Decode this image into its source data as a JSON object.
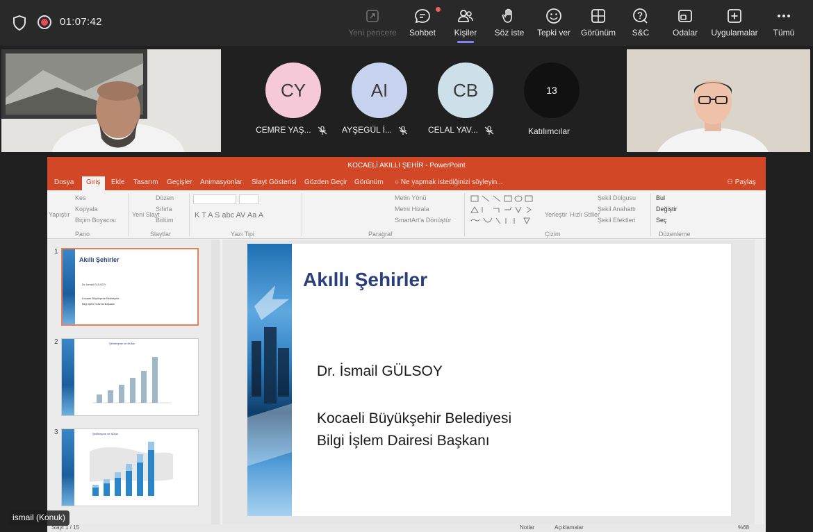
{
  "meeting": {
    "timer": "01:07:42",
    "toolbar": [
      {
        "label": "Yeni pencere",
        "icon": "new-window-icon",
        "enabled": false
      },
      {
        "label": "Sohbet",
        "icon": "chat-icon",
        "enabled": true
      },
      {
        "label": "Kişiler",
        "icon": "people-icon",
        "enabled": true,
        "active": true
      },
      {
        "label": "Söz iste",
        "icon": "raise-hand-icon",
        "enabled": true
      },
      {
        "label": "Tepki ver",
        "icon": "smiley-icon",
        "enabled": true
      },
      {
        "label": "Görünüm",
        "icon": "grid-icon",
        "enabled": true
      },
      {
        "label": "S&C",
        "icon": "qa-icon",
        "enabled": true
      },
      {
        "label": "Odalar",
        "icon": "rooms-icon",
        "enabled": true
      },
      {
        "label": "Uygulamalar",
        "icon": "apps-icon",
        "enabled": true
      },
      {
        "label": "Tümü",
        "icon": "more-icon",
        "enabled": true
      }
    ],
    "participants": [
      {
        "initials": "CY",
        "name": "CEMRE YAŞ...",
        "color": "#f5c9d8"
      },
      {
        "initials": "AI",
        "name": "AYŞEGÜL İ...",
        "color": "#c7d3ee"
      },
      {
        "initials": "CB",
        "name": "CELAL YAV...",
        "color": "#cde0ea"
      }
    ],
    "more_participants": {
      "count": "13",
      "label": "Katılımcılar"
    },
    "presenter_tag": "ismail (Konuk)"
  },
  "powerpoint": {
    "window_title": "KOCAELİ AKILLI ŞEHİR - PowerPoint",
    "tabs": [
      "Dosya",
      "Giriş",
      "Ekle",
      "Tasarım",
      "Geçişler",
      "Animasyonlar",
      "Slayt Gösterisi",
      "Gözden Geçir",
      "Görünüm"
    ],
    "selected_tab": "Giriş",
    "tell_me": "Ne yapmak istediğinizi söyleyin...",
    "share": "Paylaş",
    "ribbon": {
      "clipboard": {
        "paste": "Yapıştır",
        "cut": "Kes",
        "copy": "Kopyala",
        "format": "Biçim Boyacısı",
        "group": "Pano"
      },
      "slides": {
        "new": "Yeni Slayt",
        "layout": "Düzen",
        "reset": "Sıfırla",
        "section": "Bölüm",
        "group": "Slaytlar"
      },
      "font": {
        "group": "Yazı Tipi"
      },
      "paragraph": {
        "direction": "Metin Yönü",
        "align": "Metni Hizala",
        "smartart": "SmartArt'a Dönüştür",
        "group": "Paragraf"
      },
      "drawing": {
        "arrange": "Yerleştir",
        "quick_styles": "Hızlı Stiller",
        "fill": "Şekil Dolgusu",
        "outline": "Şekil Anahattı",
        "effects": "Şekil Efektleri",
        "group": "Çizim"
      },
      "editing": {
        "find": "Bul",
        "replace": "Değiştir",
        "select": "Seç",
        "group": "Düzenleme"
      }
    },
    "thumbnails": [
      {
        "num": "1",
        "title": "Akıllı Şehirler"
      },
      {
        "num": "2",
        "title": "Şehirleşme ve Nüfus"
      },
      {
        "num": "3",
        "title": "Şehirleşme ve Nüfus"
      }
    ],
    "slide": {
      "title": "Akıllı Şehirler",
      "author": "Dr. İsmail GÜLSOY",
      "org_line1": "Kocaeli Büyükşehir Belediyesi",
      "org_line2": "Bilgi İşlem Dairesi Başkanı"
    },
    "status": {
      "slide_counter": "Slayt 1 / 15",
      "notes": "Notlar",
      "comments": "Açıklamalar",
      "zoom": "%68"
    }
  }
}
